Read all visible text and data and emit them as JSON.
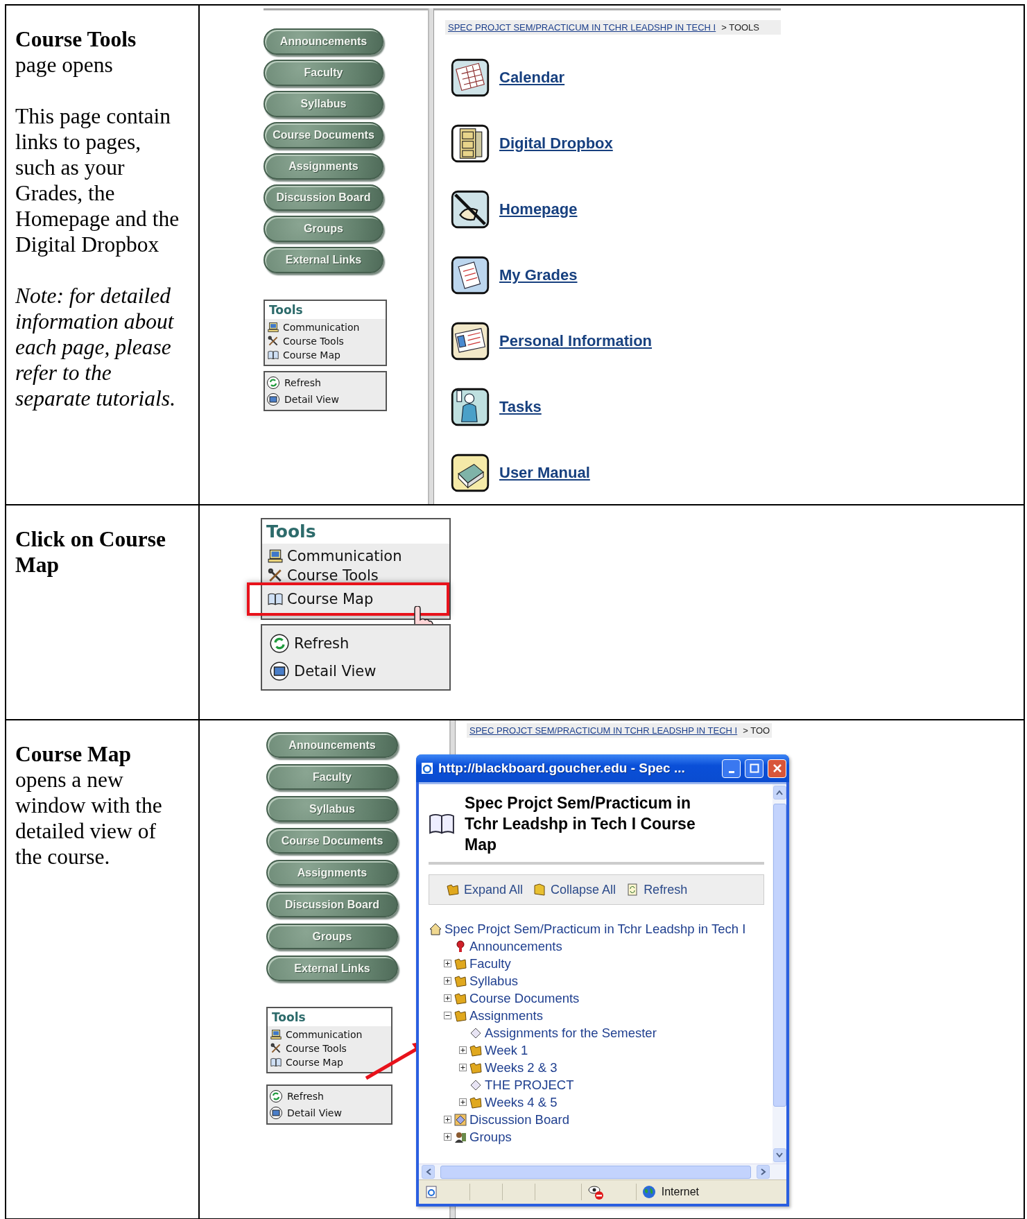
{
  "steps": [
    {
      "paragraphs": [
        {
          "kind": "text",
          "text": "**Course Tools** page opens"
        },
        {
          "kind": "text",
          "text": "This page contain links to pages, such as your Grades, the Homepage and the Digital Dropbox"
        },
        {
          "kind": "note",
          "text": "Note: for detailed information about each page, please refer to the separate tutorials."
        }
      ],
      "screenshot": {
        "kind": "tools_page",
        "nav_buttons": [
          "Announcements",
          "Faculty",
          "Syllabus",
          "Course Documents",
          "Assignments",
          "Discussion Board",
          "Groups",
          "External Links"
        ],
        "tools_menu": {
          "title": "Tools",
          "items": [
            {
              "kind": "computer",
              "label": "Communication"
            },
            {
              "kind": "tools",
              "label": "Course Tools"
            },
            {
              "kind": "book",
              "label": "Course Map"
            }
          ]
        },
        "options": [
          {
            "kind": "refresh",
            "label": "Refresh"
          },
          {
            "kind": "detail",
            "label": "Detail View"
          }
        ],
        "breadcrumb": {
          "link": "SPEC PROJCT SEM/PRACTICUM IN TCHR LEADSHP IN TECH I",
          "current": "> TOOLS"
        },
        "tool_links": [
          {
            "kind": "calendar",
            "label": "Calendar"
          },
          {
            "kind": "cabinet",
            "label": "Digital Dropbox"
          },
          {
            "kind": "pencil",
            "label": "Homepage"
          },
          {
            "kind": "document",
            "label": "My Grades"
          },
          {
            "kind": "card",
            "label": "Personal Information"
          },
          {
            "kind": "person",
            "label": "Tasks"
          },
          {
            "kind": "manual",
            "label": "User Manual"
          }
        ]
      }
    },
    {
      "paragraphs": [
        {
          "kind": "heading",
          "text": "Click on Course Map"
        }
      ],
      "screenshot": {
        "kind": "tools_zoom",
        "tools_menu": {
          "title": "Tools",
          "items": [
            {
              "kind": "computer",
              "label": "Communication",
              "highlighted": false
            },
            {
              "kind": "tools",
              "label": "Course Tools",
              "highlighted": false
            },
            {
              "kind": "book",
              "label": "Course Map",
              "highlighted": true
            }
          ]
        },
        "options": [
          {
            "kind": "refresh",
            "label": "Refresh"
          },
          {
            "kind": "detail",
            "label": "Detail View"
          }
        ]
      }
    },
    {
      "paragraphs": [
        {
          "kind": "text",
          "text": "**Course Map** opens a new window with the detailed view of the course."
        }
      ],
      "screenshot": {
        "kind": "course_map",
        "nav_buttons": [
          "Announcements",
          "Faculty",
          "Syllabus",
          "Course Documents",
          "Assignments",
          "Discussion Board",
          "Groups",
          "External Links"
        ],
        "tools_menu": {
          "title": "Tools",
          "items": [
            {
              "kind": "computer",
              "label": "Communication"
            },
            {
              "kind": "tools",
              "label": "Course Tools"
            },
            {
              "kind": "book",
              "label": "Course Map"
            }
          ]
        },
        "options": [
          {
            "kind": "refresh",
            "label": "Refresh"
          },
          {
            "kind": "detail",
            "label": "Detail View"
          }
        ],
        "breadcrumb": {
          "link": "SPEC PROJCT SEM/PRACTICUM IN TCHR LEADSHP IN TECH I",
          "current": "> TOO"
        },
        "popup": {
          "title": "http://blackboard.goucher.edu - Spec ...",
          "heading": "Spec Projct Sem/Practicum in Tchr Leadshp in Tech I Course Map",
          "toolbar": [
            {
              "kind": "expand",
              "label": "Expand All"
            },
            {
              "kind": "collapse",
              "label": "Collapse All"
            },
            {
              "kind": "refresh",
              "label": "Refresh"
            }
          ],
          "tree": {
            "kind": "home",
            "label": "Spec Projct Sem/Practicum in Tchr Leadshp in Tech I",
            "children": [
              {
                "kind": "announcement",
                "label": "Announcements"
              },
              {
                "kind": "folder",
                "label": "Faculty",
                "expanded": false
              },
              {
                "kind": "folder",
                "label": "Syllabus",
                "expanded": false
              },
              {
                "kind": "folder",
                "label": "Course Documents",
                "expanded": false
              },
              {
                "kind": "folder",
                "label": "Assignments",
                "expanded": true,
                "children": [
                  {
                    "kind": "item",
                    "label": "Assignments for the Semester"
                  },
                  {
                    "kind": "folder",
                    "label": "Week 1",
                    "expanded": false
                  },
                  {
                    "kind": "folder",
                    "label": "Weeks 2 & 3",
                    "expanded": false
                  },
                  {
                    "kind": "item",
                    "label": "THE PROJECT"
                  },
                  {
                    "kind": "folder",
                    "label": "Weeks 4 & 5",
                    "expanded": false
                  }
                ]
              },
              {
                "kind": "board",
                "label": "Discussion Board",
                "expanded": false
              },
              {
                "kind": "group",
                "label": "Groups",
                "expanded": false
              }
            ]
          },
          "status": "Internet"
        }
      }
    }
  ]
}
